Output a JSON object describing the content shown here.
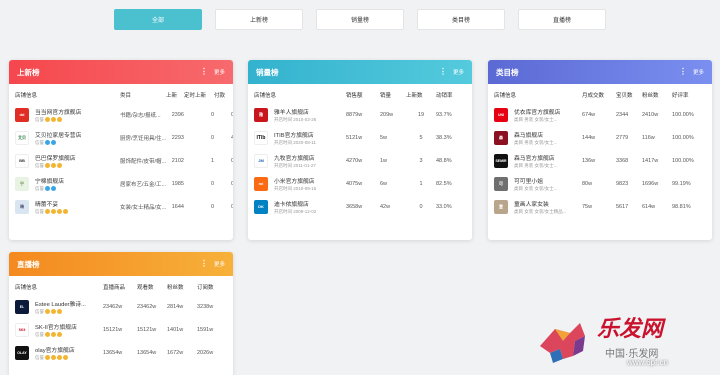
{
  "tabs": [
    "全部",
    "上新榜",
    "销量榜",
    "类目榜",
    "直播榜"
  ],
  "more_label": "更多",
  "shangxin": {
    "title": "上新榜",
    "headers": [
      "店铺信息",
      "类目",
      "上新",
      "定时上新",
      "付款"
    ],
    "rows": [
      {
        "name": "当当网官方旗舰店",
        "sub": "信誉",
        "cat": "书籍/杂志/报纸...",
        "a": "2396",
        "b": "0",
        "c": "0"
      },
      {
        "name": "艾贝拉家居专营店",
        "sub": "信誉",
        "cat": "厨房/烹饪用具/住...",
        "a": "2293",
        "b": "0",
        "c": "4"
      },
      {
        "name": "巴巴保罗旗舰店",
        "sub": "信誉",
        "cat": "服饰配件/皮带/帽...",
        "a": "2102",
        "b": "1",
        "c": "0"
      },
      {
        "name": "宁棉旗舰店",
        "sub": "信誉",
        "cat": "居家布艺/五金/工...",
        "a": "1985",
        "b": "0",
        "c": "0"
      },
      {
        "name": "晴蕾不妥",
        "sub": "信誉",
        "cat": "女装/女士精品/女...",
        "a": "1644",
        "b": "0",
        "c": "0"
      }
    ]
  },
  "xiaoliang": {
    "title": "销量榜",
    "headers": [
      "店铺信息",
      "销售额",
      "销量",
      "上新数",
      "动销率"
    ],
    "rows": [
      {
        "name": "雅羊人旗舰店",
        "sub": "开店时间 2010-03-26",
        "a": "8879w",
        "b": "209w",
        "c": "19",
        "d": "93.7%"
      },
      {
        "name": "ITIB官方旗舰店",
        "sub": "开店时间 2020-08-11",
        "a": "5121w",
        "b": "5w",
        "c": "5",
        "d": "38.3%"
      },
      {
        "name": "九牧官方旗舰店",
        "sub": "开店时间 2011-01-27",
        "a": "4270w",
        "b": "1w",
        "c": "3",
        "d": "48.8%"
      },
      {
        "name": "小米官方旗舰店",
        "sub": "开店时间 2010-09-15",
        "a": "4075w",
        "b": "6w",
        "c": "1",
        "d": "82.5%"
      },
      {
        "name": "迪卡侬旗舰店",
        "sub": "开店时间 2009-12-02",
        "a": "3658w",
        "b": "42w",
        "c": "0",
        "d": "33.0%"
      }
    ]
  },
  "leimu": {
    "title": "类目榜",
    "headers": [
      "店铺信息",
      "月成交数",
      "宝贝数",
      "粉丝数",
      "好评率"
    ],
    "rows": [
      {
        "name": "优衣库官方旗舰店",
        "sub": "类目 男装 女装/女士...",
        "a": "674w",
        "b": "2344",
        "c": "2410w",
        "d": "100.00%"
      },
      {
        "name": "森马旗舰店",
        "sub": "类目 男装 女装/女士...",
        "a": "144w",
        "b": "2779",
        "c": "116w",
        "d": "100.00%"
      },
      {
        "name": "森马官方旗舰店",
        "sub": "类目 男装 女装/女士...",
        "a": "136w",
        "b": "3368",
        "c": "1417w",
        "d": "100.00%"
      },
      {
        "name": "可可里小姐",
        "sub": "类目 女装 女装/女士...",
        "a": "80w",
        "b": "9823",
        "c": "1696w",
        "d": "99.19%"
      },
      {
        "name": "童画人家女装",
        "sub": "类目 女装 女装/女士精品...",
        "a": "75w",
        "b": "5617",
        "c": "614w",
        "d": "98.81%"
      }
    ]
  },
  "zhibo": {
    "title": "直播榜",
    "headers": [
      "店铺信息",
      "直播商品",
      "观看数",
      "粉丝数",
      "订阅数"
    ],
    "rows": [
      {
        "name": "Estee Lauder雅诗...",
        "sub": "信誉",
        "a": "23462w",
        "b": "23462w",
        "c": "2814w",
        "d": "3238w"
      },
      {
        "name": "SK-II官方旗舰店",
        "sub": "信誉",
        "a": "15121w",
        "b": "15121w",
        "c": "1401w",
        "d": "1591w"
      },
      {
        "name": "olay官方旗舰店",
        "sub": "信誉",
        "a": "13654w",
        "b": "13654w",
        "c": "1672w",
        "d": "2026w"
      }
    ]
  },
  "watermark": {
    "brand": "乐发网",
    "sub": "中国·乐发网",
    "url": "www.6pf.cn"
  }
}
